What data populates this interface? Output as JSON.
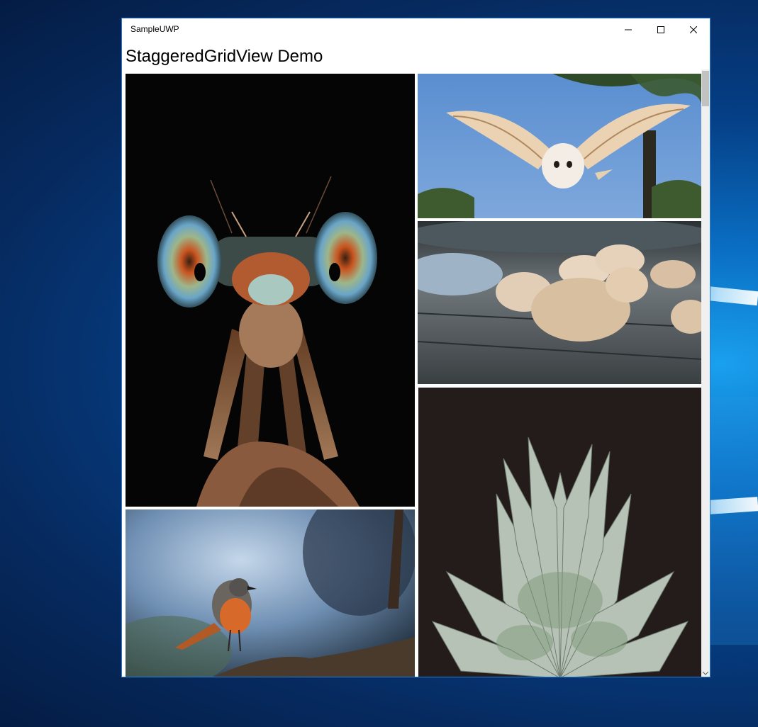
{
  "window": {
    "title": "SampleUWP",
    "heading": "StaggeredGridView Demo"
  },
  "caption_buttons": [
    {
      "name": "minimize-button",
      "icon": "minimize-icon"
    },
    {
      "name": "maximize-button",
      "icon": "maximize-icon"
    },
    {
      "name": "close-button",
      "icon": "close-icon"
    }
  ],
  "gallery": {
    "items": [
      {
        "subject": "damselfly"
      },
      {
        "subject": "barn-owl"
      },
      {
        "subject": "seashells"
      },
      {
        "subject": "redstart-bird"
      },
      {
        "subject": "pineapple"
      }
    ]
  },
  "colors": {
    "window_border": "#2b7bd0",
    "desktop_accent": "#0a6fc4"
  }
}
